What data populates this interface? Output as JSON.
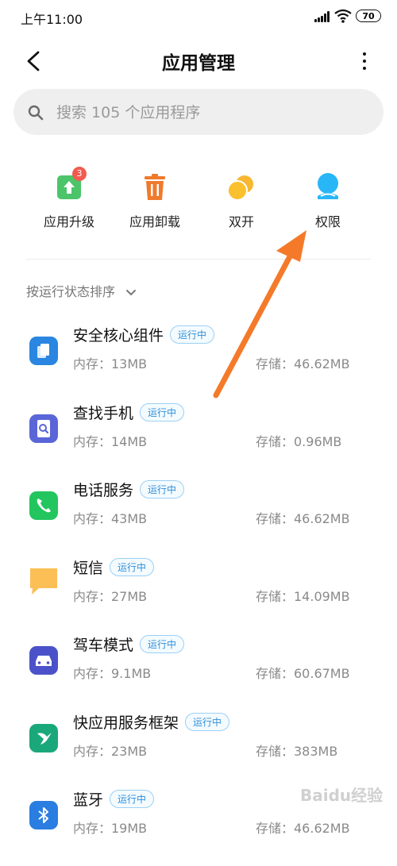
{
  "status_bar": {
    "time": "上午11:00",
    "battery": "70"
  },
  "header": {
    "title": "应用管理"
  },
  "search": {
    "placeholder": "搜索 105 个应用程序"
  },
  "quick_actions": [
    {
      "label": "应用升级",
      "icon": "upgrade-icon",
      "badge": "3",
      "color": "#4cc46a"
    },
    {
      "label": "应用卸载",
      "icon": "trash-icon",
      "color": "#f07a2c"
    },
    {
      "label": "双开",
      "icon": "dual-app-icon",
      "color": "#f7b731"
    },
    {
      "label": "权限",
      "icon": "permission-icon",
      "color": "#29b6f6"
    }
  ],
  "sort": {
    "label": "按运行状态排序"
  },
  "apps": [
    {
      "name": "安全核心组件",
      "status": "运行中",
      "memory": "内存：13MB",
      "storage": "存储：46.62MB",
      "icon": "security-core-icon",
      "color": "#2a86e0"
    },
    {
      "name": "查找手机",
      "status": "运行中",
      "memory": "内存：14MB",
      "storage": "存储：0.96MB",
      "icon": "find-phone-icon",
      "color": "#5a66d8"
    },
    {
      "name": "电话服务",
      "status": "运行中",
      "memory": "内存：43MB",
      "storage": "存储：46.62MB",
      "icon": "phone-icon",
      "color": "#22c55e"
    },
    {
      "name": "短信",
      "status": "运行中",
      "memory": "内存：27MB",
      "storage": "存储：14.09MB",
      "icon": "sms-icon",
      "color": "#fbbf55"
    },
    {
      "name": "驾车模式",
      "status": "运行中",
      "memory": "内存：9.1MB",
      "storage": "存储：60.67MB",
      "icon": "car-mode-icon",
      "color": "#4b52c9"
    },
    {
      "name": "快应用服务框架",
      "status": "运行中",
      "memory": "内存：23MB",
      "storage": "存储：383MB",
      "icon": "quick-app-icon",
      "color": "#1aa87a"
    },
    {
      "name": "蓝牙",
      "status": "运行中",
      "memory": "内存：19MB",
      "storage": "存储：46.62MB",
      "icon": "bluetooth-icon",
      "color": "#2a7de1"
    }
  ],
  "annotation": {
    "color": "#f47a2a"
  },
  "watermark": {
    "text": "Baidu经验"
  }
}
